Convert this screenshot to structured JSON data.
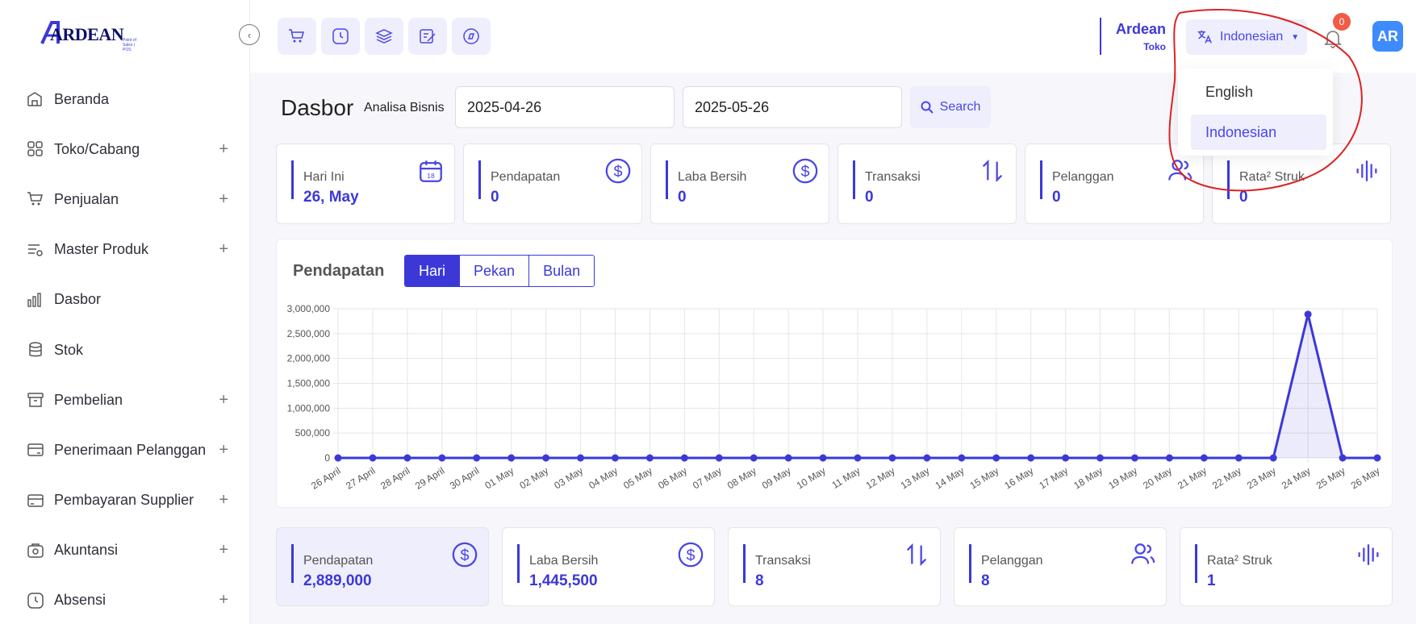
{
  "app": {
    "logo_text": "ARDEAN",
    "logo_tagline": "Point of Sales | POS"
  },
  "sidebar": {
    "items": [
      {
        "label": "Beranda",
        "icon": "home-icon",
        "expandable": false
      },
      {
        "label": "Toko/Cabang",
        "icon": "store-icon",
        "expandable": true
      },
      {
        "label": "Penjualan",
        "icon": "cart-icon",
        "expandable": true
      },
      {
        "label": "Master Produk",
        "icon": "product-list-icon",
        "expandable": true
      },
      {
        "label": "Dasbor",
        "icon": "chart-bars-icon",
        "expandable": false
      },
      {
        "label": "Stok",
        "icon": "database-icon",
        "expandable": false
      },
      {
        "label": "Pembelian",
        "icon": "box-icon",
        "expandable": true
      },
      {
        "label": "Penerimaan Pelanggan",
        "icon": "card-in-icon",
        "expandable": true
      },
      {
        "label": "Pembayaran Supplier",
        "icon": "card-out-icon",
        "expandable": true
      },
      {
        "label": "Akuntansi",
        "icon": "accounting-icon",
        "expandable": true
      },
      {
        "label": "Absensi",
        "icon": "clock-icon",
        "expandable": true
      }
    ],
    "plus_symbol": "+"
  },
  "topbar": {
    "quick_icons": [
      "cart-icon",
      "clock-icon",
      "layers-icon",
      "edit-note-icon",
      "compass-icon"
    ],
    "store_name": "Ardean",
    "store_sub": "Toko",
    "language": "Indonesian",
    "notification_count": "0",
    "avatar_text": "AR"
  },
  "language_menu": {
    "options": [
      "English",
      "Indonesian"
    ],
    "selected": "Indonesian"
  },
  "dashboard": {
    "title": "Dasbor",
    "subtitle": "Analisa Bisnis",
    "date_from": "2025-04-26",
    "date_to": "2025-05-26",
    "search_label": "Search"
  },
  "today_cards": [
    {
      "title": "Hari Ini",
      "value": "26, May",
      "icon": "calendar-icon"
    },
    {
      "title": "Pendapatan",
      "value": "0",
      "icon": "dollar-circle-icon"
    },
    {
      "title": "Laba Bersih",
      "value": "0",
      "icon": "dollar-circle-icon"
    },
    {
      "title": "Transaksi",
      "value": "0",
      "icon": "transfer-arrows-icon"
    },
    {
      "title": "Pelanggan",
      "value": "0",
      "icon": "users-icon"
    },
    {
      "title": "Rata² Struk",
      "value": "0",
      "icon": "waveform-icon"
    }
  ],
  "chart_panel": {
    "title": "Pendapatan",
    "tabs": [
      "Hari",
      "Pekan",
      "Bulan"
    ],
    "active_tab": "Hari"
  },
  "chart_data": {
    "type": "line",
    "x": [
      "26 April",
      "27 April",
      "28 April",
      "29 April",
      "30 April",
      "01 May",
      "02 May",
      "03 May",
      "04 May",
      "05 May",
      "06 May",
      "07 May",
      "08 May",
      "09 May",
      "10 May",
      "11 May",
      "12 May",
      "13 May",
      "14 May",
      "15 May",
      "16 May",
      "17 May",
      "18 May",
      "19 May",
      "20 May",
      "21 May",
      "22 May",
      "23 May",
      "24 May",
      "25 May",
      "26 May"
    ],
    "series": [
      {
        "values": [
          0,
          0,
          0,
          0,
          0,
          0,
          0,
          0,
          0,
          0,
          0,
          0,
          0,
          0,
          0,
          0,
          0,
          0,
          0,
          0,
          0,
          0,
          0,
          0,
          0,
          0,
          0,
          0,
          2889000,
          0,
          0
        ]
      }
    ],
    "ylim": [
      0,
      3000000
    ],
    "yticks": [
      "3,000,000",
      "2,500,000",
      "2,000,000",
      "1,500,000",
      "1,000,000",
      "500,000",
      "0"
    ],
    "grid": true,
    "color": "#3c38d8"
  },
  "summary_cards": [
    {
      "title": "Pendapatan",
      "value": "2,889,000",
      "icon": "dollar-circle-icon"
    },
    {
      "title": "Laba Bersih",
      "value": "1,445,500",
      "icon": "dollar-circle-icon"
    },
    {
      "title": "Transaksi",
      "value": "8",
      "icon": "transfer-arrows-icon"
    },
    {
      "title": "Pelanggan",
      "value": "8",
      "icon": "users-icon"
    },
    {
      "title": "Rata² Struk",
      "value": "1",
      "icon": "waveform-icon"
    }
  ],
  "colors": {
    "accent": "#3c38d8",
    "accent_light": "#eeeefc",
    "badge": "#f25a45",
    "annotation": "#d22"
  }
}
